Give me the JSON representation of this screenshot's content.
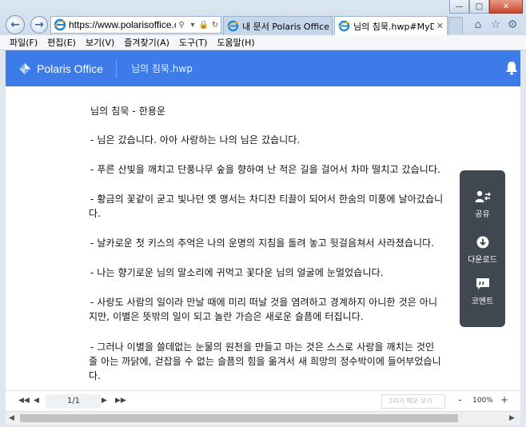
{
  "browser": {
    "url": "https://www.polarisoffice.com/",
    "tabs": [
      {
        "label": "내 문서 Polaris Office"
      },
      {
        "label": "님의 침묵.hwp#MyDo..."
      }
    ],
    "menu": [
      "파일(F)",
      "편집(E)",
      "보기(V)",
      "즐겨찾기(A)",
      "도구(T)",
      "도움말(H)"
    ]
  },
  "app": {
    "brand": "Polaris Office",
    "doc_title": "님의 침묵.hwp"
  },
  "document": {
    "lines": [
      "님의 침묵 - 한용운",
      "- 님은 갔습니다. 아아 사랑하는 나의 님은 갔습니다.",
      "- 푸른 산빛을 깨치고 단풍나무 숲을 향하여 난 적은 길을 걸어서 차마 떨치고 갔습니다.",
      "- 황금의 꽃같이 굳고 빛나던 옛 맹서는 차디찬 티끌이 되어서 한숨의 미풍에 날아갔습니",
      "다.",
      "- 날카로운 첫 키스의 추억은 나의 운명의 지침을 돌려 놓고 뒷걸음쳐서 사라졌습니다.",
      "- 나는 향기로운 님의 말소리에 귀먹고 꽃다운 님의 얼굴에 눈멀었습니다.",
      "- 사랑도 사람의 일이라 만날 때에 미리 떠날 것을 염려하고 경계하지 아니한 것은 아니",
      "지만, 이별은 뜻밖의 일이 되고 놀란 가슴은 새로운 슬픔에 터집니다.",
      "- 그러나 이별을 쓸데없는 눈물의 원천을 만들고 마는 것은 스스로 사랑을 깨치는 것인",
      "줄 아는 까닭에, 걷잡을 수 없는 슬픔의 힘을 옮겨서 새 희망의 정수박이에 들어부었습니",
      "다."
    ]
  },
  "float_panel": {
    "share": "공유",
    "download": "다운로드",
    "comment": "코멘트"
  },
  "bottom_bar": {
    "page": "1/1",
    "memo_placeholder": "그리기 메모 보기",
    "zoom_minus": "-",
    "zoom": "100%",
    "zoom_plus": "+"
  },
  "colors": {
    "header_blue": "#3c7be8",
    "panel_dark": "#3f4750"
  }
}
